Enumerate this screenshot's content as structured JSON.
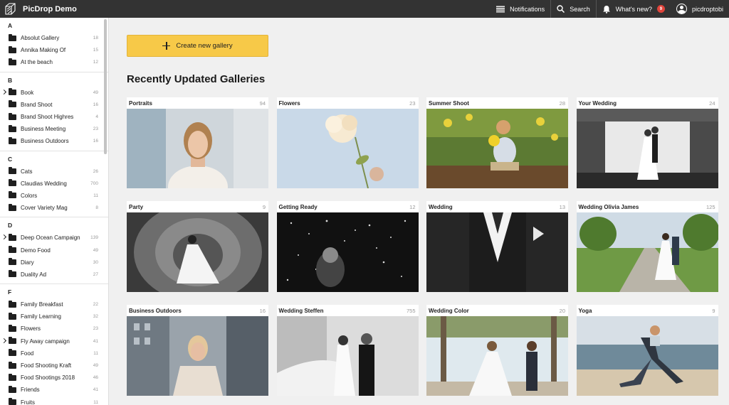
{
  "app": {
    "title": "PicDrop Demo",
    "logo_icon": "picdrop-logo"
  },
  "topbar": {
    "notifications_label": "Notifications",
    "search_label": "Search",
    "whats_new_label": "What's new?",
    "whats_new_count": "9",
    "username": "picdroptobi"
  },
  "sidebar": {
    "groups": [
      {
        "letter": "A",
        "items": [
          {
            "label": "Absolut Gallery",
            "count": "18"
          },
          {
            "label": "Annika Making Of",
            "count": "15"
          },
          {
            "label": "At the beach",
            "count": "12"
          }
        ]
      },
      {
        "letter": "B",
        "items": [
          {
            "label": "Book",
            "count": "49",
            "expandable": true
          },
          {
            "label": "Brand Shoot",
            "count": "16"
          },
          {
            "label": "Brand Shoot Highres",
            "count": "4"
          },
          {
            "label": "Business Meeting",
            "count": "23"
          },
          {
            "label": "Business Outdoors",
            "count": "16"
          }
        ]
      },
      {
        "letter": "C",
        "items": [
          {
            "label": "Cats",
            "count": "26"
          },
          {
            "label": "Claudias Wedding",
            "count": "700"
          },
          {
            "label": "Colors",
            "count": "11"
          },
          {
            "label": "Cover Variety Mag",
            "count": "8"
          }
        ]
      },
      {
        "letter": "D",
        "items": [
          {
            "label": "Deep Ocean Campaign",
            "count": "139",
            "expandable": true
          },
          {
            "label": "Demo Food",
            "count": "49"
          },
          {
            "label": "Diary",
            "count": "30"
          },
          {
            "label": "Duality Ad",
            "count": "27"
          }
        ]
      },
      {
        "letter": "F",
        "items": [
          {
            "label": "Family Breakfast",
            "count": "22"
          },
          {
            "label": "Family Learning",
            "count": "32"
          },
          {
            "label": "Flowers",
            "count": "23"
          },
          {
            "label": "Fly Away campaign",
            "count": "41",
            "expandable": true
          },
          {
            "label": "Food",
            "count": "11"
          },
          {
            "label": "Food Shooting Kraft",
            "count": "49"
          },
          {
            "label": "Food Shootings 2018",
            "count": "46"
          },
          {
            "label": "Friends",
            "count": "41"
          },
          {
            "label": "Fruits",
            "count": "11"
          }
        ]
      }
    ]
  },
  "main": {
    "create_label": "Create new gallery",
    "section_title": "Recently Updated Galleries",
    "galleries": [
      {
        "title": "Portraits",
        "count": "94"
      },
      {
        "title": "Flowers",
        "count": "23"
      },
      {
        "title": "Summer Shoot",
        "count": "28"
      },
      {
        "title": "Your Wedding",
        "count": "24"
      },
      {
        "title": "Party",
        "count": "9"
      },
      {
        "title": "Getting Ready",
        "count": "12"
      },
      {
        "title": "Wedding",
        "count": "13"
      },
      {
        "title": "Wedding Olivia James",
        "count": "125"
      },
      {
        "title": "Business Outdoors",
        "count": "16"
      },
      {
        "title": "Wedding Steffen",
        "count": "755"
      },
      {
        "title": "Wedding Color",
        "count": "20"
      },
      {
        "title": "Yoga",
        "count": "9"
      }
    ]
  },
  "colors": {
    "topbar": "#333333",
    "accent": "#f7c948",
    "badge": "#e0443b"
  }
}
